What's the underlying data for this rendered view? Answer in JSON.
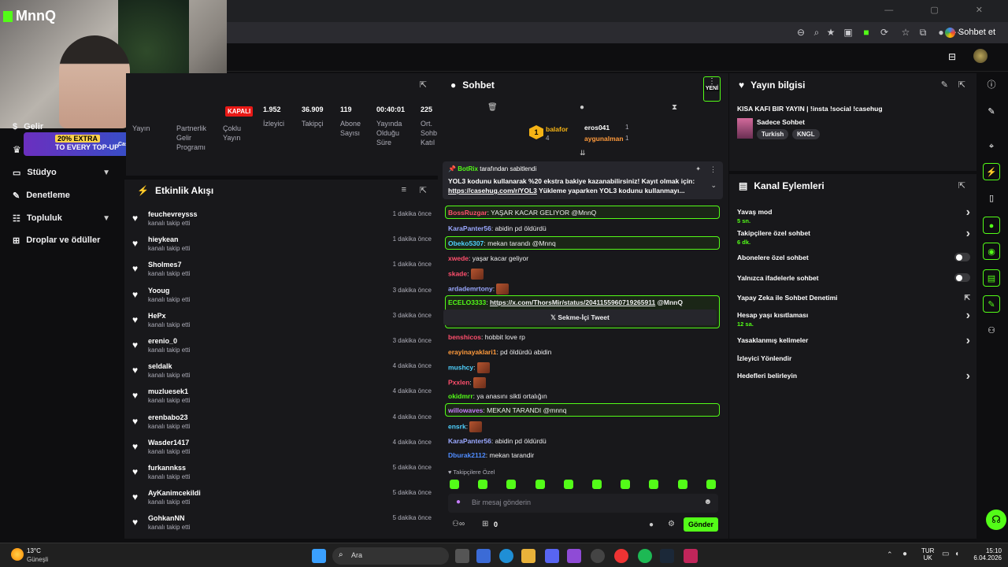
{
  "browser": {
    "sohbet_et": "Sohbet et"
  },
  "cam": {
    "channel": "MnnQ"
  },
  "promo": {
    "line1": "20% EXTRA",
    "line2": "TO EVERY TOP-UP",
    "brand": "Casehug"
  },
  "nav": {
    "items": [
      {
        "label": "Gelir"
      },
      {
        "label": "Stüdyo"
      },
      {
        "label": "Denetleme"
      },
      {
        "label": "Topluluk"
      },
      {
        "label": "Droplar ve ödüller"
      }
    ]
  },
  "stats": {
    "status": "KAPALI",
    "left_labels": [
      "Yayın",
      "Partnerlik Gelir Programı",
      "Çoklu Yayın"
    ],
    "items": [
      {
        "value": "1.952",
        "label": "İzleyici"
      },
      {
        "value": "36.909",
        "label": "Takipçi"
      },
      {
        "value": "119",
        "label": "Abone Sayısı"
      },
      {
        "value": "00:40:01",
        "label": "Yayında Olduğu Süre"
      },
      {
        "value": "225",
        "label": "Ort. Sohb Katıl"
      }
    ]
  },
  "feed": {
    "title": "Etkinlik Akışı",
    "items": [
      {
        "name": "feuchevreysss",
        "sub": "kanalı takip etti",
        "time": "1 dakika önce"
      },
      {
        "name": "hieykean",
        "sub": "kanalı takip etti",
        "time": "1 dakika önce"
      },
      {
        "name": "Sholmes7",
        "sub": "kanalı takip etti",
        "time": "1 dakika önce"
      },
      {
        "name": "Yooug",
        "sub": "kanalı takip etti",
        "time": "3 dakika önce"
      },
      {
        "name": "HePx",
        "sub": "kanalı takip etti",
        "time": "3 dakika önce"
      },
      {
        "name": "erenio_0",
        "sub": "kanalı takip etti",
        "time": "3 dakika önce"
      },
      {
        "name": "seldalk",
        "sub": "kanalı takip etti",
        "time": "4 dakika önce"
      },
      {
        "name": "muzluesek1",
        "sub": "kanalı takip etti",
        "time": "4 dakika önce"
      },
      {
        "name": "erenbabo23",
        "sub": "kanalı takip etti",
        "time": "4 dakika önce"
      },
      {
        "name": "Wasder1417",
        "sub": "kanalı takip etti",
        "time": "4 dakika önce"
      },
      {
        "name": "furkannkss",
        "sub": "kanalı takip etti",
        "time": "5 dakika önce"
      },
      {
        "name": "AyKanimcekildi",
        "sub": "kanalı takip etti",
        "time": "5 dakika önce"
      },
      {
        "name": "GohkanNN",
        "sub": "kanalı takip etti",
        "time": "5 dakika önce"
      }
    ]
  },
  "chat": {
    "title": "Sohbet",
    "new_badge": "YENİ",
    "leaders": [
      {
        "name": "balafor",
        "count": "4"
      },
      {
        "name": "eros041",
        "count": "1"
      },
      {
        "name": "aygunalman",
        "count": "1"
      }
    ],
    "pinned": {
      "by": "BotRix",
      "by_suffix": "tarafından sabitlendi",
      "text": "YOL3 kodunu kullanarak %20 ekstra bakiye kazanabilirsiniz! Kayıt olmak için:",
      "link": "https://casehug.com/r/YOL3",
      "rest": "Yükleme yaparken YOL3 kodunu kullanmayı..."
    },
    "messages": [
      {
        "user": "BossRuzgar",
        "text": ": YAŞAR KACAR GELIYOR @MnnQ",
        "color": "#ff4f6d",
        "highlight": true
      },
      {
        "user": "KaraPanter56",
        "text": ": abidin pd öldürdü",
        "color": "#9aa8ff",
        "highlight": false
      },
      {
        "user": "Obeko5307",
        "text": ": mekan tarandı @Mnnq",
        "color": "#4fd1ff",
        "highlight": true
      },
      {
        "user": "xwede",
        "text": ": yaşar kacar geliyor",
        "color": "#ff4f6d",
        "highlight": false
      },
      {
        "user": "skade",
        "text": ":",
        "color": "#ff4f6d",
        "highlight": false,
        "emote": true
      },
      {
        "user": "ardademrtony",
        "text": ":",
        "color": "#9aa8ff",
        "highlight": false,
        "emote": true
      },
      {
        "user": "ECELO3333",
        "text": ":",
        "color": "#53fc18",
        "highlight": true,
        "link": "https://x.com/ThorsMir/status/2041155960719265911",
        "mention": "@MnnQ",
        "tweet": "Sekme-İçi Tweet"
      },
      {
        "user": "benshicos",
        "text": ": hobbit love rp",
        "color": "#ff4f6d",
        "highlight": false
      },
      {
        "user": "erayinayaklari1",
        "text": ": pd öldürdü abidin",
        "color": "#ff9a3c",
        "highlight": false
      },
      {
        "user": "mushcy",
        "text": ":",
        "color": "#4fd1ff",
        "highlight": false,
        "emote": true
      },
      {
        "user": "Pxxlen",
        "text": ":",
        "color": "#ff4f6d",
        "highlight": false,
        "emote": true
      },
      {
        "user": "okidmrr",
        "text": ": ya anasını sikti ortalığın",
        "color": "#53fc18",
        "highlight": false
      },
      {
        "user": "willowaves",
        "text": ": MEKAN TARANDI @mnnq",
        "color": "#c77dff",
        "highlight": true
      },
      {
        "user": "ensrk",
        "text": ":",
        "color": "#4fd1ff",
        "highlight": false,
        "emote": true
      },
      {
        "user": "KaraPanter56",
        "text": ": abidin pd öldürdü",
        "color": "#9aa8ff",
        "highlight": false
      },
      {
        "user": "Dburak2112",
        "text": ": mekan tarandir",
        "color": "#4f8cff",
        "highlight": false
      }
    ],
    "followers_only": "Takipçilere Özel",
    "placeholder": "Bir mesaj gönderin",
    "count": "0",
    "send": "Gönder"
  },
  "info": {
    "title": "Yayın bilgisi",
    "stream_title": "KISA KAFI BIR YAYIN | !insta !social !casehug",
    "category": "Sadece Sohbet",
    "tags": [
      "Turkish",
      "KNGL"
    ]
  },
  "actions": {
    "title": "Kanal Eylemleri",
    "items": [
      {
        "label": "Yavaş mod",
        "sub": "5 sn.",
        "type": "arrow"
      },
      {
        "label": "Takipçilere özel sohbet",
        "sub": "6 dk.",
        "type": "arrow"
      },
      {
        "label": "Abonelere özel sohbet",
        "sub": "",
        "type": "toggle"
      },
      {
        "label": "Yalnızca ifadelerle sohbet",
        "sub": "",
        "type": "toggle"
      },
      {
        "label": "Yapay Zeka ile Sohbet Denetimi",
        "sub": "",
        "type": "ext"
      },
      {
        "label": "Hesap yaşı kısıtlaması",
        "sub": "12 sa.",
        "type": "arrow"
      },
      {
        "label": "Yasaklanmış kelimeler",
        "sub": "",
        "type": "arrow"
      },
      {
        "label": "İzleyici Yönlendir",
        "sub": "",
        "type": "none"
      },
      {
        "label": "Hedefleri belirleyin",
        "sub": "",
        "type": "arrow"
      }
    ]
  },
  "taskbar": {
    "weather_temp": "13°C",
    "weather_desc": "Güneşli",
    "search": "Ara",
    "lang1": "TUR",
    "lang2": "UK",
    "time": "15:10",
    "date": "6.04.2026"
  },
  "colors": {
    "accent": "#53fc18",
    "panel": "#18181b",
    "bg": "#0e0e10"
  }
}
